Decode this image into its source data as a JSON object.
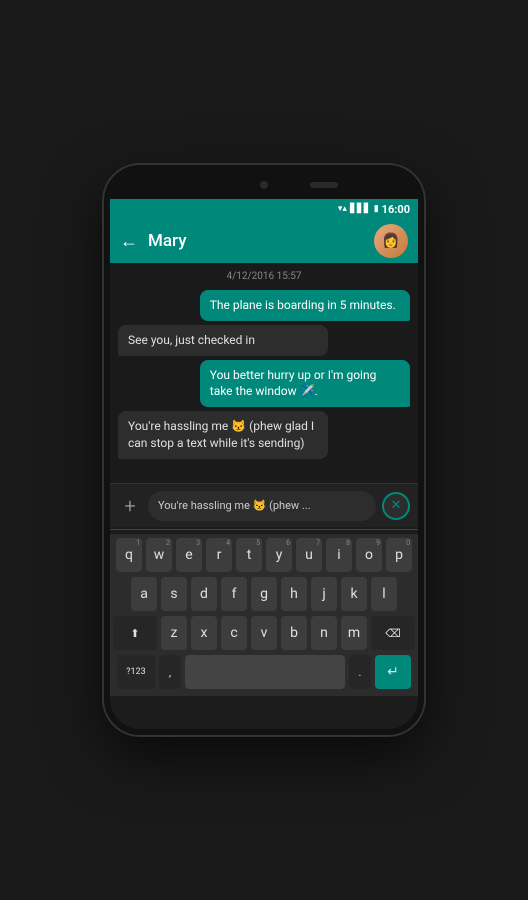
{
  "statusBar": {
    "time": "16:00"
  },
  "header": {
    "backLabel": "←",
    "contactName": "Mary"
  },
  "chat": {
    "timestamp": "4/12/2016 15:57",
    "messages": [
      {
        "id": 1,
        "type": "sent",
        "text": "The plane is boarding in 5 minutes."
      },
      {
        "id": 2,
        "type": "received",
        "text": "See you, just checked in"
      },
      {
        "id": 3,
        "type": "sent",
        "text": "You better hurry up or I'm going take the window ✈️."
      },
      {
        "id": 4,
        "type": "received",
        "text": "You're hassling me 😾 (phew glad I can stop a text while it's sending)"
      }
    ]
  },
  "inputArea": {
    "plusLabel": "+",
    "typingText": "You're hassling me 😾 (phew ...",
    "cancelLabel": "✕"
  },
  "keyboard": {
    "rows": [
      [
        "q",
        "w",
        "e",
        "r",
        "t",
        "y",
        "u",
        "i",
        "o",
        "p"
      ],
      [
        "a",
        "s",
        "d",
        "f",
        "g",
        "h",
        "j",
        "k",
        "l"
      ],
      [
        "z",
        "x",
        "c",
        "v",
        "b",
        "n",
        "m"
      ],
      [
        "?123",
        ",",
        ".",
        " ",
        "↵"
      ]
    ],
    "numbers": [
      "1",
      "2",
      "3",
      "4",
      "5",
      "6",
      "7",
      "8",
      "9",
      "0"
    ]
  }
}
